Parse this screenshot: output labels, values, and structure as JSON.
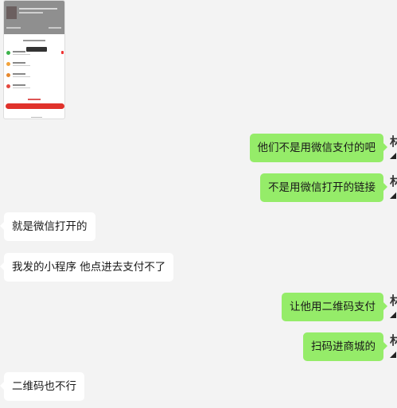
{
  "messages": [
    {
      "from": "other",
      "type": "image"
    },
    {
      "from": "self",
      "text": "他们不是用微信支付的吧"
    },
    {
      "from": "self",
      "text": "不是用微信打开的链接"
    },
    {
      "from": "other",
      "text": "就是微信打开的"
    },
    {
      "from": "other",
      "text": "我发的小程序 他点进去支付不了"
    },
    {
      "from": "self",
      "text": "让他用二维码支付"
    },
    {
      "from": "self",
      "text": "扫码进商城的"
    },
    {
      "from": "other",
      "text": "二维码也不行"
    }
  ],
  "self_avatar_glyph": "林",
  "colors": {
    "background": "#f3f3f3",
    "incoming_bubble": "#ffffff",
    "outgoing_bubble": "#95ec69"
  }
}
